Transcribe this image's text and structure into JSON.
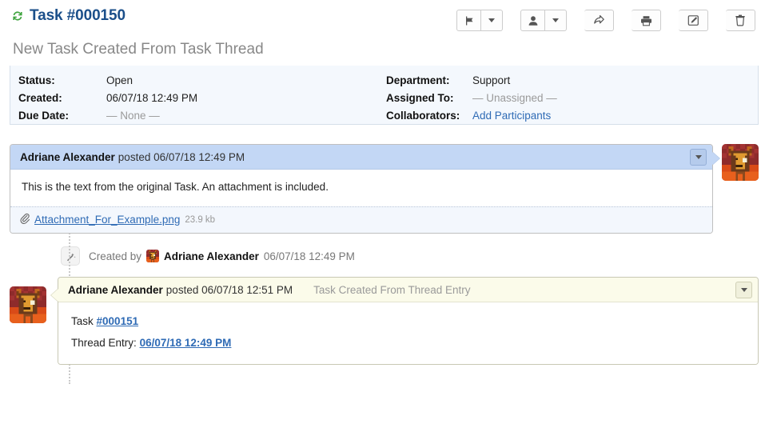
{
  "header": {
    "refresh_icon": "refresh-icon",
    "title": "Task #000150",
    "subtitle": "New Task Created From Task Thread"
  },
  "toolbar": {
    "buttons": [
      {
        "name": "flag-button",
        "icon": "flag-icon",
        "label": ""
      },
      {
        "name": "flag-dropdown-button",
        "icon": "chevron-down-icon",
        "label": ""
      },
      {
        "name": "assign-user-button",
        "icon": "user-icon",
        "label": ""
      },
      {
        "name": "assign-user-dropdown-button",
        "icon": "chevron-down-icon",
        "label": ""
      },
      {
        "name": "transfer-button",
        "icon": "share-icon",
        "label": ""
      },
      {
        "name": "print-button",
        "icon": "printer-icon",
        "label": ""
      },
      {
        "name": "edit-button",
        "icon": "pencil-square-icon",
        "label": ""
      },
      {
        "name": "delete-button",
        "icon": "trash-icon",
        "label": ""
      }
    ]
  },
  "info": {
    "left": [
      {
        "label": "Status:",
        "value": "Open",
        "muted": false,
        "link": false
      },
      {
        "label": "Created:",
        "value": "06/07/18 12:49 PM",
        "muted": false,
        "link": false
      },
      {
        "label": "Due Date:",
        "value": "— None —",
        "muted": true,
        "link": false
      }
    ],
    "right": [
      {
        "label": "Department:",
        "value": "Support",
        "muted": false,
        "link": false
      },
      {
        "label": "Assigned To:",
        "value": "— Unassigned —",
        "muted": true,
        "link": false
      },
      {
        "label": "Collaborators:",
        "value": "Add Participants",
        "muted": false,
        "link": true
      }
    ]
  },
  "thread": {
    "message1": {
      "author": "Adriane Alexander",
      "posted": "posted 06/07/18 12:49 PM",
      "body": "This is the text from the original Task. An attachment is included.",
      "attachment": {
        "icon": "paperclip-icon",
        "name": "Attachment_For_Example.png",
        "size": "23.9 kb"
      },
      "menu_icon": "chevron-down-icon",
      "avatar": "user-avatar"
    },
    "event": {
      "icon": "magic-wand-icon",
      "label": "Created by",
      "author": "Adriane Alexander",
      "timestamp": "06/07/18 12:49 PM",
      "avatar": "user-avatar"
    },
    "message2": {
      "author": "Adriane Alexander",
      "posted": "posted 06/07/18 12:51 PM",
      "entry_title": "Task Created From Thread Entry",
      "line1_label": "Task",
      "line1_link": "#000151",
      "line2_label": "Thread Entry:",
      "line2_link": "06/07/18 12:49 PM",
      "menu_icon": "chevron-down-icon",
      "avatar": "user-avatar"
    }
  },
  "colors": {
    "title_blue": "#1b4f8a",
    "link_blue": "#2f6bb5",
    "refresh_green": "#3ea33e",
    "panel_blue_header": "#c3d7f5",
    "panel_yellow_header": "#fbfbea",
    "info_bg": "#f4f8fd"
  }
}
